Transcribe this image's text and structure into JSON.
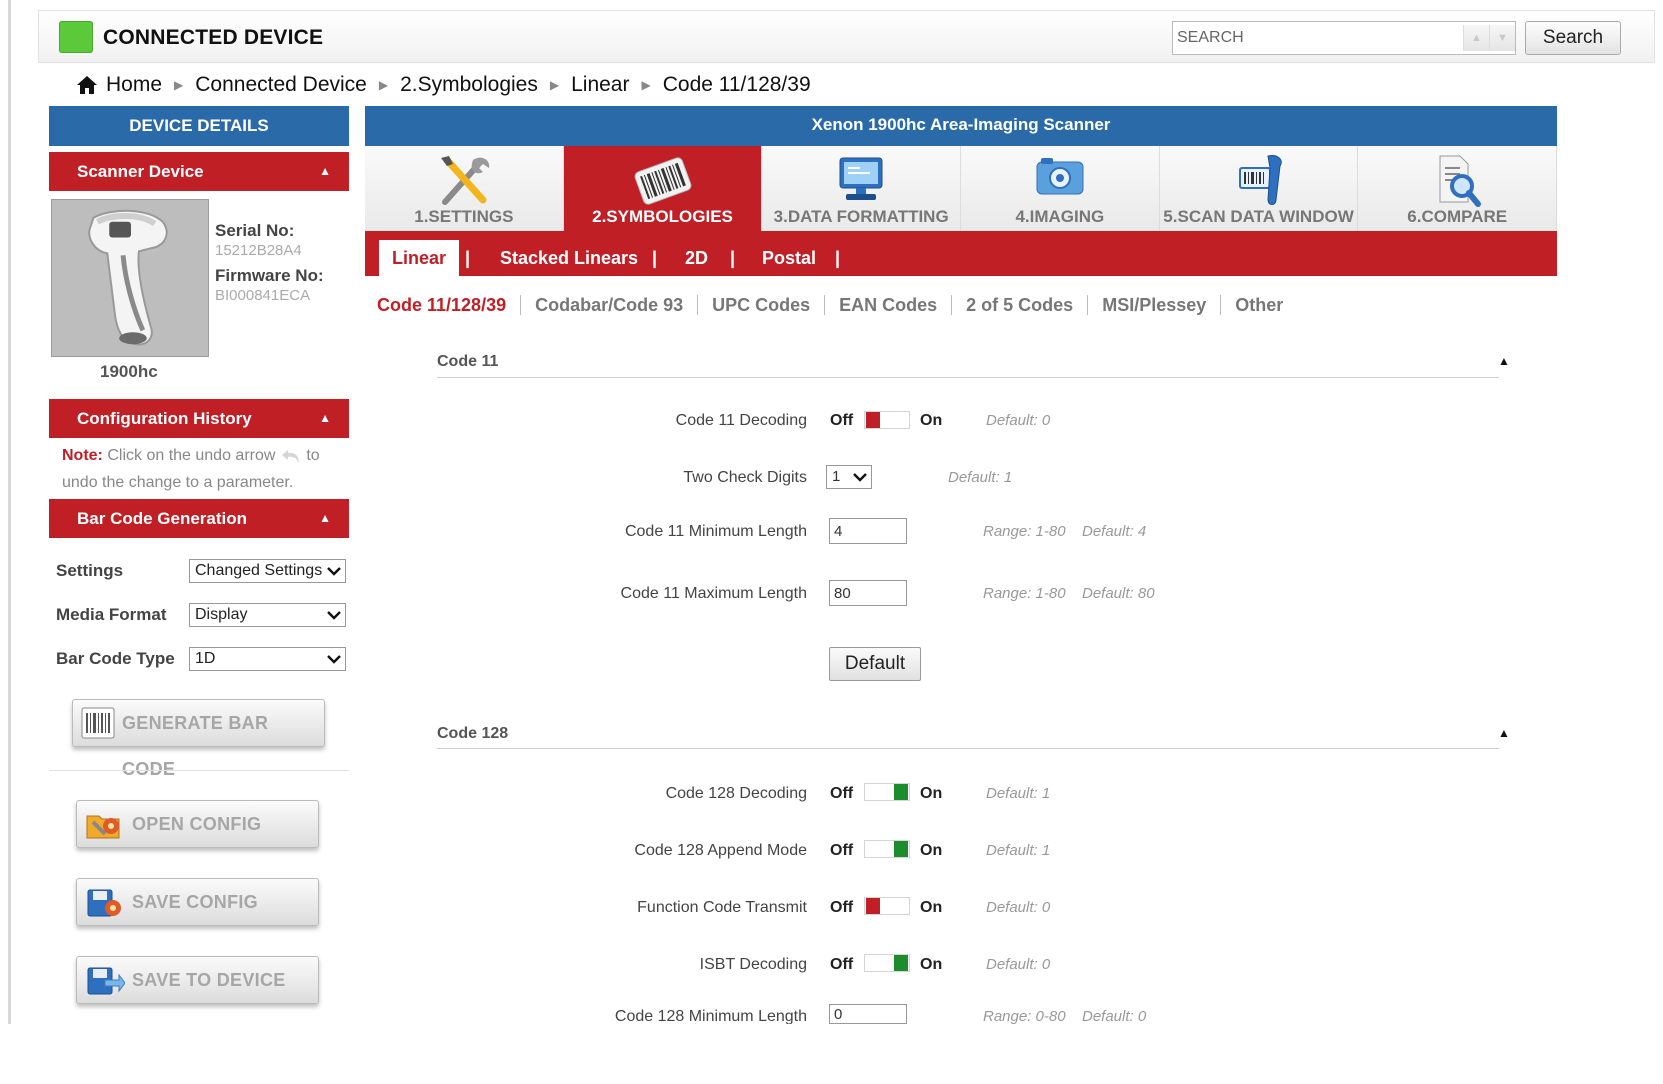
{
  "header": {
    "title": "CONNECTED DEVICE",
    "search_placeholder": "SEARCH",
    "search_button": "Search",
    "led_color": "#5cc93a"
  },
  "breadcrumb": [
    "Home",
    "Connected Device",
    "2.Symbologies",
    "Linear",
    "Code 11/128/39"
  ],
  "sidebar": {
    "device_details": "DEVICE DETAILS",
    "scanner_device": {
      "title": "Scanner Device",
      "serial_label": "Serial No:",
      "serial_value": "15212B28A4",
      "firmware_label": "Firmware No:",
      "firmware_value": "BI000841ECA",
      "model": "1900hc"
    },
    "config_history": {
      "title": "Configuration History",
      "note_label": "Note:",
      "note_text_1": " Click on the undo arrow ",
      "note_text_2": " to undo the change to a parameter."
    },
    "barcode_generation": {
      "title": "Bar Code Generation",
      "settings_label": "Settings",
      "settings_value": "Changed Settings",
      "media_label": "Media Format",
      "media_value": "Display",
      "type_label": "Bar Code Type",
      "type_value": "1D",
      "generate_button": "GENERATE BAR CODE"
    },
    "open_config": "OPEN CONFIG",
    "save_config": "SAVE CONFIG",
    "save_to_device": "SAVE TO DEVICE"
  },
  "main": {
    "title": "Xenon 1900hc Area-Imaging Scanner",
    "tabs": [
      {
        "label": "1.SETTINGS",
        "icon": "tools-icon"
      },
      {
        "label": "2.SYMBOLOGIES",
        "icon": "barcode-icon"
      },
      {
        "label": "3.DATA FORMATTING",
        "icon": "monitor-icon"
      },
      {
        "label": "4.IMAGING",
        "icon": "camera-icon"
      },
      {
        "label": "5.SCAN DATA WINDOW",
        "icon": "scanner-icon"
      },
      {
        "label": "6.COMPARE",
        "icon": "magnifier-doc-icon"
      }
    ],
    "active_tab": 1,
    "subtabs": [
      "Linear",
      "Stacked Linears",
      "2D",
      "Postal"
    ],
    "subsubtabs": [
      "Code 11/128/39",
      "Codabar/Code 93",
      "UPC Codes",
      "EAN Codes",
      "2 of 5 Codes",
      "MSI/Plessey",
      "Other"
    ]
  },
  "code11": {
    "title": "Code 11",
    "decoding": {
      "label": "Code 11 Decoding",
      "off": "Off",
      "on": "On",
      "state": "off",
      "default": "Default: 0"
    },
    "check_digits": {
      "label": "Two Check Digits",
      "value": "1",
      "default": "Default: 1"
    },
    "min_length": {
      "label": "Code 11 Minimum Length",
      "value": "4",
      "range": "Range: 1-80",
      "default": "Default: 4"
    },
    "max_length": {
      "label": "Code 11 Maximum Length",
      "value": "80",
      "range": "Range: 1-80",
      "default": "Default: 80"
    },
    "default_button": "Default"
  },
  "code128": {
    "title": "Code 128",
    "rows": [
      {
        "label": "Code 128 Decoding",
        "off": "Off",
        "on": "On",
        "state": "on",
        "default": "Default: 1"
      },
      {
        "label": "Code 128 Append Mode",
        "off": "Off",
        "on": "On",
        "state": "on",
        "default": "Default: 1"
      },
      {
        "label": "Function Code Transmit",
        "off": "Off",
        "on": "On",
        "state": "off",
        "default": "Default: 0"
      },
      {
        "label": "ISBT Decoding",
        "off": "Off",
        "on": "On",
        "state": "on",
        "default": "Default: 0"
      }
    ],
    "min_length": {
      "label": "Code 128 Minimum Length",
      "value": "0",
      "range": "Range: 0-80",
      "default": "Default: 0"
    }
  },
  "colors": {
    "brand_blue": "#2b6aa8",
    "brand_red": "#c01f26",
    "toggle_on": "#1c8c2c"
  }
}
